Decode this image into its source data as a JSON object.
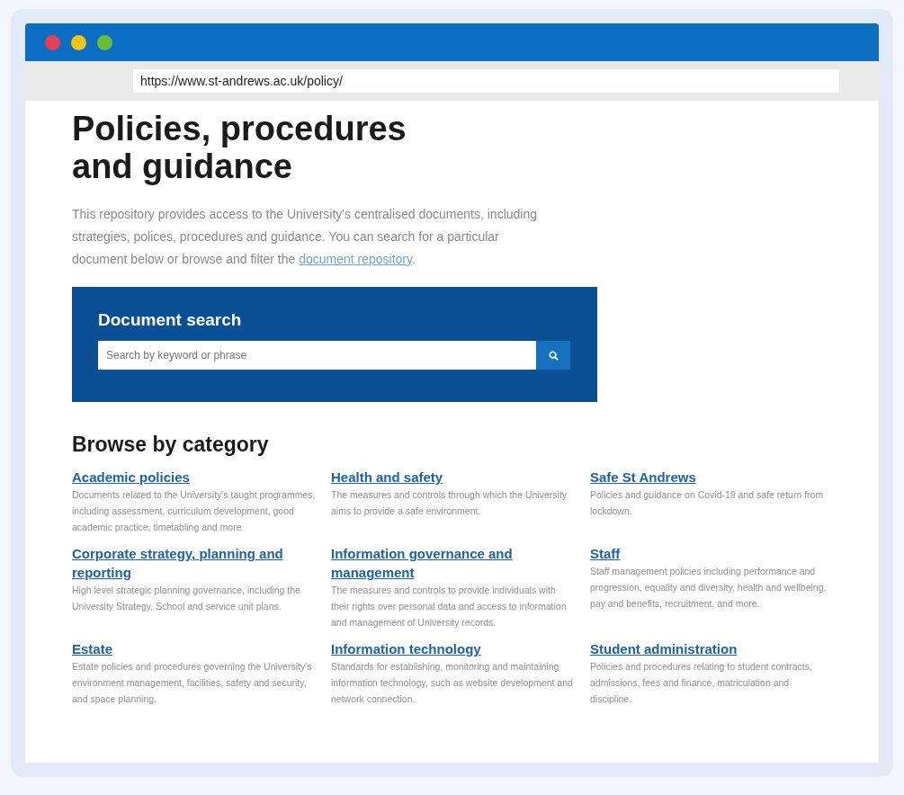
{
  "browser": {
    "url": "https://www.st-andrews.ac.uk/policy/"
  },
  "page": {
    "title": "Policies, procedures and guidance",
    "intro": "This repository provides access to the University's centralised documents, including strategies, polices, procedures and guidance. You can search for a particular document below or browse and filter the ",
    "intro_link": "document repository",
    "intro_end": "."
  },
  "search": {
    "heading": "Document search",
    "placeholder": "Search by keyword or phrase"
  },
  "browse": {
    "heading": "Browse by category",
    "categories": [
      {
        "title": "Academic policies",
        "description": "Documents related to the University's taught programmes, including assessment, curriculum development, good academic practice, timetabling and more"
      },
      {
        "title": "Health and safety",
        "description": "The measures and controls through which the University aims to provide a safe environment."
      },
      {
        "title": "Safe St Andrews",
        "description": "Policies and guidance on Covid-19 and safe return from lockdown."
      },
      {
        "title": "Corporate strategy, planning and reporting",
        "description": "High level strategic planning governance, including the University Strategy, School and service unit plans."
      },
      {
        "title": "Information governance and management",
        "description": "The measures and controls to provide individuals with their rights over personal data and access to information and management of University records."
      },
      {
        "title": "Staff",
        "description": "Staff management policies including performance and progression, equality and diversity, health and wellbeing, pay and benefits, recruitment, and more."
      },
      {
        "title": "Estate",
        "description": "Estate policies and procedures governing the University's environment management, facilities, safety and security, and space planning."
      },
      {
        "title": "Information technology",
        "description": "Standards for establishing, monitoring and maintaining information technology, such as website development and network connection."
      },
      {
        "title": "Student administration",
        "description": "Policies and procedures relating to student contracts, admissions, fees and finance, matriculation and discipline."
      }
    ]
  }
}
